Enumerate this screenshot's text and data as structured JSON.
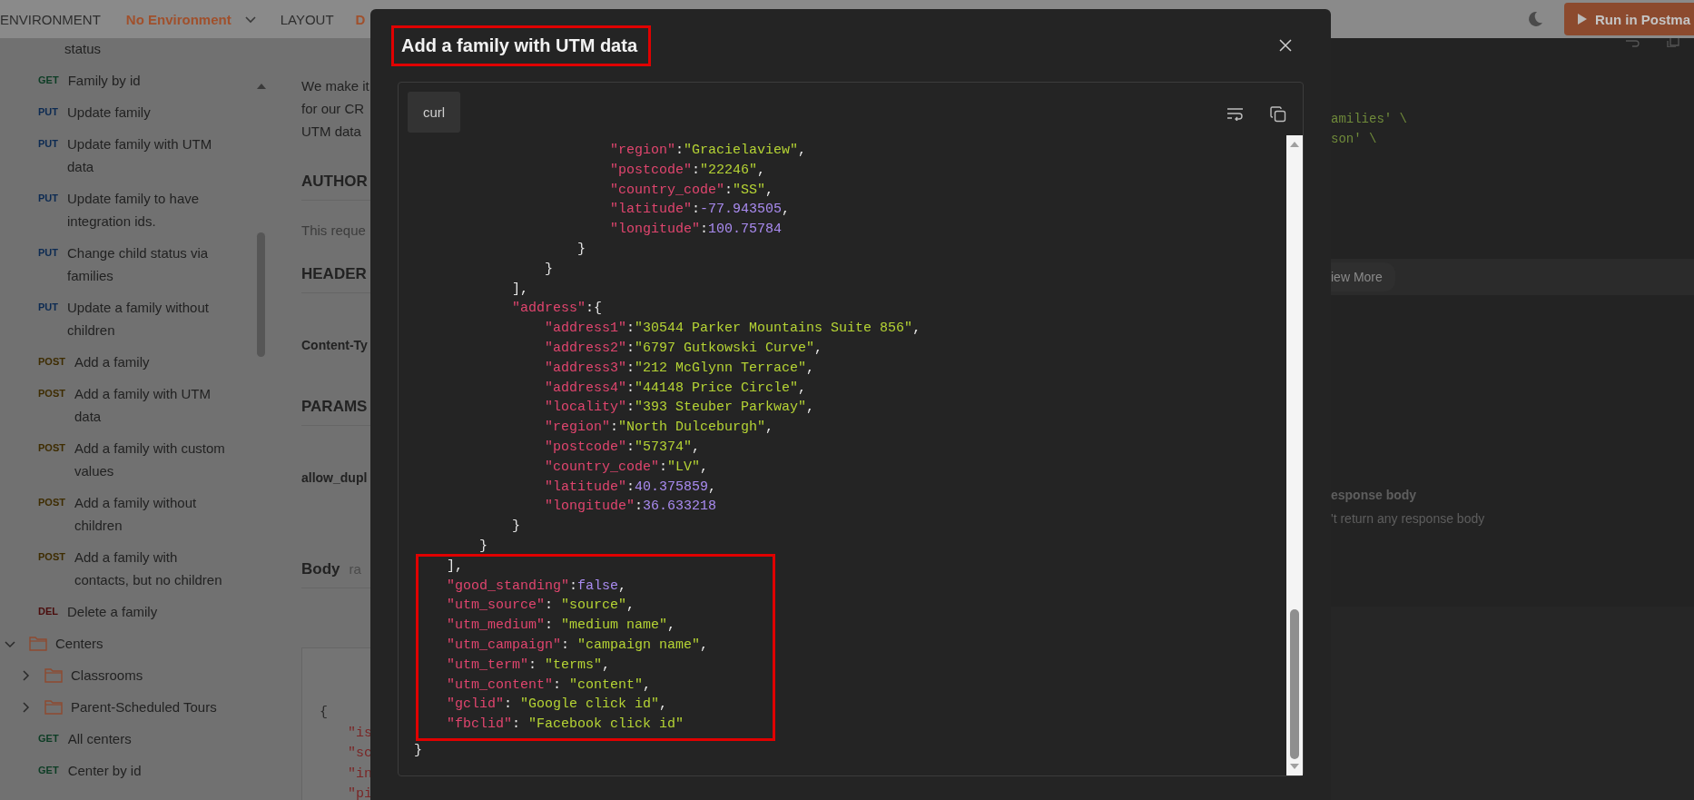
{
  "top_bar": {
    "environment_label": "ENVIRONMENT",
    "environment_value": "No Environment",
    "layout_label": "LAYOUT",
    "cut_label": "D",
    "run_button": "Run in Postma"
  },
  "sidebar": {
    "items": [
      {
        "kind": "folder-continued",
        "children": [
          {
            "kind": "fragment",
            "label": "status"
          },
          {
            "kind": "request",
            "method": "GET",
            "color": "#0c3c24",
            "label": "Family by id"
          },
          {
            "kind": "request",
            "method": "PUT",
            "color": "#0c2a52",
            "label": "Update family"
          },
          {
            "kind": "request",
            "method": "PUT",
            "color": "#0c2a52",
            "label": "Update family with UTM data"
          },
          {
            "kind": "request",
            "method": "PUT",
            "color": "#0c2a52",
            "label": "Update family to have integration ids."
          },
          {
            "kind": "request",
            "method": "PUT",
            "color": "#0c2a52",
            "label": "Change child status via families"
          },
          {
            "kind": "request",
            "method": "PUT",
            "color": "#0c2a52",
            "label": "Update a family without children"
          },
          {
            "kind": "request",
            "method": "POST",
            "color": "#3e2c00",
            "label": "Add a family"
          },
          {
            "kind": "request",
            "method": "POST",
            "color": "#3e2c00",
            "label": "Add a family with UTM data"
          },
          {
            "kind": "request",
            "method": "POST",
            "color": "#3e2c00",
            "label": "Add a family with custom values"
          },
          {
            "kind": "request",
            "method": "POST",
            "color": "#3e2c00",
            "label": "Add a family without children"
          },
          {
            "kind": "request",
            "method": "POST",
            "color": "#3e2c00",
            "label": "Add a family with contacts, but no children"
          },
          {
            "kind": "request",
            "method": "DEL",
            "color": "#4a0c0c",
            "label": "Delete a family"
          }
        ]
      },
      {
        "kind": "folder",
        "label": "Centers",
        "expanded": true,
        "children": [
          {
            "kind": "folder",
            "label": "Classrooms",
            "expanded": false
          },
          {
            "kind": "folder",
            "label": "Parent-Scheduled Tours",
            "expanded": false
          },
          {
            "kind": "request",
            "method": "GET",
            "color": "#0c3c24",
            "label": "All centers"
          },
          {
            "kind": "request",
            "method": "GET",
            "color": "#0c3c24",
            "label": "Center by id"
          }
        ]
      }
    ]
  },
  "docs": {
    "intro_lines": [
      "We make it",
      "for our CR",
      "UTM data"
    ],
    "authorization_heading": "AUTHOR",
    "authorization_text": "This reque",
    "headers_heading": "HEADER",
    "header_key": "Content-Ty",
    "params_heading": "PARAMS",
    "param_key": "allow_dupl",
    "body_heading": "Body",
    "body_type": "ra",
    "body_lines": [
      "{",
      "\"is",
      "\"sc",
      "\"in",
      "\"pi"
    ]
  },
  "right_panel": {
    "code_lines": [
      "amilies' \\",
      "son' \\"
    ],
    "view_more": "iew More",
    "response_heading": "esponse body",
    "response_text": "'t return any response body"
  },
  "dialog": {
    "title": "Add a family with UTM data",
    "title_highlighted": true,
    "tab": "curl",
    "blocks": [
      {
        "highlighted": false,
        "lines": [
          "                        \"region\":\"Gracielaview\",",
          "                        \"postcode\":\"22246\",",
          "                        \"country_code\":\"SS\",",
          "                        \"latitude\":-77.943505,",
          "                        \"longitude\":100.75784",
          "                    }",
          "                }",
          "            ],",
          "            \"address\":{",
          "                \"address1\":\"30544 Parker Mountains Suite 856\",",
          "                \"address2\":\"6797 Gutkowski Curve\",",
          "                \"address3\":\"212 McGlynn Terrace\",",
          "                \"address4\":\"44148 Price Circle\",",
          "                \"locality\":\"393 Steuber Parkway\",",
          "                \"region\":\"North Dulceburgh\",",
          "                \"postcode\":\"57374\",",
          "                \"country_code\":\"LV\",",
          "                \"latitude\":40.375859,",
          "                \"longitude\":36.633218",
          "            }",
          "        }"
        ]
      },
      {
        "highlighted": true,
        "lines": [
          "    ],",
          "    \"good_standing\":false,",
          "    \"utm_source\": \"source\",",
          "    \"utm_medium\": \"medium name\",",
          "    \"utm_campaign\": \"campaign name\",",
          "    \"utm_term\": \"terms\",",
          "    \"utm_content\": \"content\",",
          "    \"gclid\": \"Google click id\",",
          "    \"fbclid\": \"Facebook click id\""
        ]
      },
      {
        "highlighted": false,
        "lines": [
          "}"
        ]
      }
    ]
  }
}
